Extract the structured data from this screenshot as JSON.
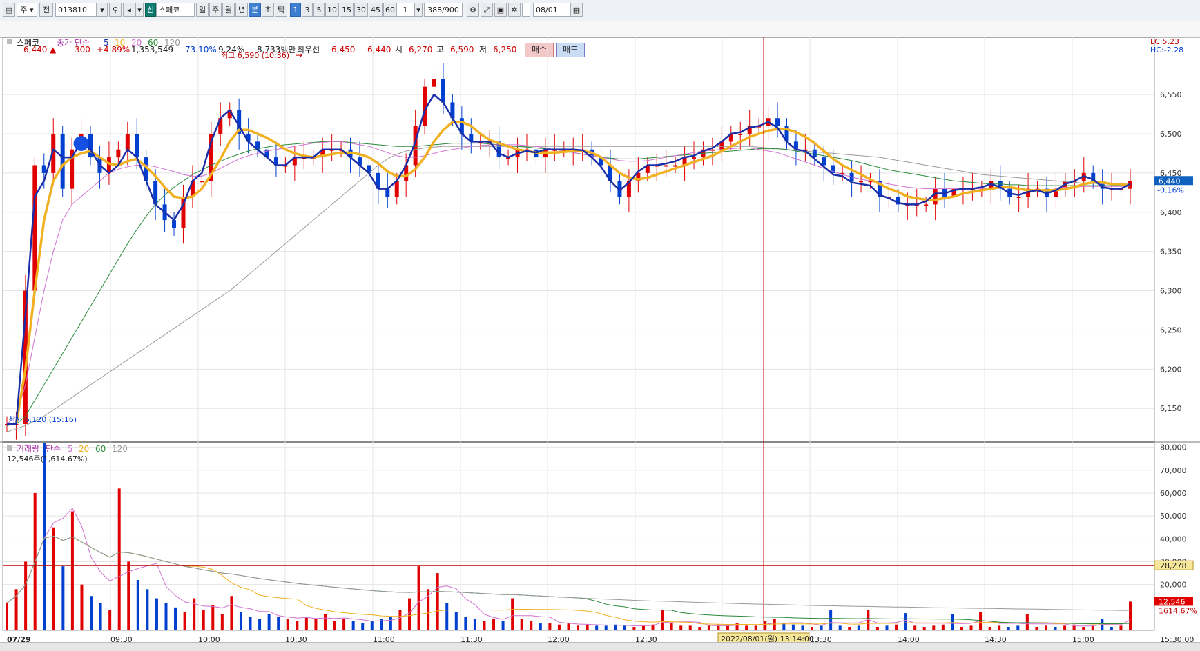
{
  "toolbar": {
    "market_mode": "주",
    "prev_label": "전",
    "stock_code": "013810",
    "new_badge": "신",
    "stock_name": "스페코",
    "period_buttons": [
      "일",
      "주",
      "월",
      "년",
      "분",
      "초",
      "틱"
    ],
    "minute_buttons": [
      "1",
      "3",
      "5",
      "10",
      "15",
      "30",
      "45",
      "60"
    ],
    "multiplier": "1",
    "count_display": "388/900",
    "date_value": "08/01"
  },
  "info": {
    "price": "6,440",
    "change": "300",
    "change_pct": "+4.89%",
    "volume": "1,353,549",
    "vol_ratio": "73.10%",
    "turnover": "9.24%",
    "amount": "8,733백만",
    "best_label": "최우선",
    "best_ask": "6,450",
    "best_bid": "6,440",
    "open_label": "시",
    "open": "6,270",
    "high_label": "고",
    "high": "6,590",
    "low_label": "저",
    "low": "6,250",
    "buy_label": "매수",
    "sell_label": "매도"
  },
  "chart_data": [
    {
      "type": "line",
      "title": "스페코",
      "legend": {
        "label": "종가 단순",
        "periods": [
          "5",
          "10",
          "20",
          "60",
          "120"
        ]
      },
      "y_ticks": [
        6150,
        6200,
        6250,
        6300,
        6350,
        6400,
        6450,
        6500,
        6550
      ],
      "ylim": [
        6108,
        6616
      ],
      "x_tick_labels": [
        "07/29",
        "09:30",
        "10:00",
        "10:30",
        "11:00",
        "11:30",
        "12:00",
        "12:30",
        "13:00",
        "13:30",
        "14:00",
        "14:30",
        "15:00",
        "15:30:00"
      ],
      "annotations": {
        "high": "최고 6,590 (10:36)",
        "low": "최저 6,120 (15:16)",
        "lc": "LC:5.23",
        "hc": "HC:-2.28",
        "last_price": "6,440",
        "last_change": "-0.16%",
        "crosshair_date": "2022/08/01(월) 13:14:00"
      },
      "colors": {
        "up": "#e00000",
        "down": "#0040d0",
        "ma5": "#1a2ea8",
        "ma10": "#f0b020",
        "ma20": "#d070d0",
        "ma60": "#2a8a3a",
        "ma120": "#999999"
      },
      "series": [
        {
          "name": "close",
          "values": [
            6130,
            6130,
            6300,
            6460,
            6450,
            6500,
            6430,
            6480,
            6500,
            6470,
            6450,
            6470,
            6480,
            6500,
            6470,
            6440,
            6410,
            6390,
            6380,
            6420,
            6440,
            6440,
            6500,
            6520,
            6530,
            6500,
            6490,
            6480,
            6470,
            6460,
            6460,
            6470,
            6470,
            6470,
            6480,
            6480,
            6480,
            6470,
            6460,
            6450,
            6430,
            6420,
            6440,
            6460,
            6510,
            6560,
            6570,
            6540,
            6520,
            6500,
            6490,
            6490,
            6490,
            6470,
            6470,
            6480,
            6480,
            6470,
            6480,
            6480,
            6480,
            6480,
            6480,
            6470,
            6460,
            6440,
            6420,
            6440,
            6450,
            6460,
            6460,
            6460,
            6460,
            6470,
            6470,
            6480,
            6480,
            6490,
            6500,
            6500,
            6510,
            6510,
            6520,
            6510,
            6490,
            6480,
            6480,
            6470,
            6460,
            6450,
            6450,
            6440,
            6440,
            6440,
            6420,
            6420,
            6410,
            6410,
            6410,
            6410,
            6430,
            6420,
            6430,
            6430,
            6430,
            6430,
            6440,
            6430,
            6420,
            6420,
            6430,
            6430,
            6420,
            6430,
            6440,
            6440,
            6450,
            6440,
            6430,
            6430,
            6430,
            6440
          ]
        },
        {
          "name": "ma5",
          "values": [
            6130,
            6130,
            6270,
            6420,
            6440,
            6480,
            6470,
            6470,
            6490,
            6480,
            6460,
            6450,
            6460,
            6480,
            6470,
            6440,
            6410,
            6400,
            6390,
            6410,
            6440,
            6450,
            6490,
            6520,
            6530,
            6510,
            6490,
            6480,
            6470,
            6460,
            6460,
            6470,
            6470,
            6470,
            6480,
            6480,
            6480,
            6470,
            6460,
            6450,
            6430,
            6430,
            6440,
            6460,
            6490,
            6530,
            6550,
            6540,
            6520,
            6500,
            6490,
            6490,
            6490,
            6475,
            6470,
            6475,
            6478,
            6476,
            6480,
            6480,
            6480,
            6480,
            6479,
            6470,
            6458,
            6440,
            6428,
            6438,
            6452,
            6460,
            6460,
            6462,
            6465,
            6470,
            6472,
            6478,
            6482,
            6490,
            6500,
            6502,
            6508,
            6510,
            6515,
            6508,
            6490,
            6480,
            6478,
            6468,
            6458,
            6448,
            6446,
            6438,
            6436,
            6434,
            6422,
            6418,
            6412,
            6410,
            6410,
            6414,
            6424,
            6424,
            6428,
            6430,
            6430,
            6432,
            6436,
            6432,
            6424,
            6422,
            6426,
            6428,
            6424,
            6428,
            6436,
            6440,
            6446,
            6442,
            6432,
            6430,
            6430,
            6436
          ]
        },
        {
          "name": "ma10",
          "values": [
            6130,
            6130,
            6200,
            6300,
            6390,
            6440,
            6460,
            6470,
            6475,
            6478,
            6470,
            6462,
            6460,
            6465,
            6468,
            6458,
            6446,
            6432,
            6420,
            6418,
            6420,
            6430,
            6448,
            6468,
            6490,
            6505,
            6505,
            6500,
            6495,
            6488,
            6480,
            6475,
            6472,
            6470,
            6472,
            6474,
            6476,
            6476,
            6474,
            6470,
            6462,
            6452,
            6446,
            6446,
            6455,
            6470,
            6490,
            6505,
            6515,
            6515,
            6510,
            6500,
            6492,
            6488,
            6484,
            6480,
            6478,
            6476,
            6476,
            6476,
            6477,
            6478,
            6478,
            6476,
            6470,
            6460,
            6450,
            6444,
            6442,
            6444,
            6448,
            6452,
            6456,
            6460,
            6464,
            6468,
            6472,
            6478,
            6484,
            6490,
            6496,
            6500,
            6504,
            6506,
            6506,
            6502,
            6496,
            6488,
            6478,
            6468,
            6460,
            6454,
            6448,
            6442,
            6436,
            6430,
            6426,
            6420,
            6418,
            6416,
            6416,
            6418,
            6420,
            6424,
            6426,
            6428,
            6430,
            6432,
            6432,
            6430,
            6428,
            6428,
            6428,
            6428,
            6430,
            6432,
            6436,
            6438,
            6438,
            6436,
            6436,
            6434
          ]
        },
        {
          "name": "ma20",
          "values": [
            6130,
            6140,
            6180,
            6240,
            6300,
            6350,
            6390,
            6410,
            6420,
            6430,
            6440,
            6450,
            6455,
            6458,
            6460,
            6460,
            6458,
            6455,
            6452,
            6448,
            6446,
            6446,
            6450,
            6456,
            6462,
            6468,
            6472,
            6475,
            6478,
            6480,
            6482,
            6484,
            6486,
            6488,
            6489,
            6490,
            6490,
            6488,
            6486,
            6484,
            6480,
            6476,
            6472,
            6470,
            6470,
            6472,
            6475,
            6478,
            6480,
            6482,
            6484,
            6485,
            6486,
            6486,
            6486,
            6486,
            6485,
            6484,
            6482,
            6480,
            6478,
            6476,
            6474,
            6472,
            6470,
            6468,
            6466,
            6465,
            6465,
            6466,
            6468,
            6470,
            6472,
            6474,
            6476,
            6478,
            6479,
            6480,
            6481,
            6482,
            6482,
            6480,
            6478,
            6476,
            6472,
            6468,
            6464,
            6460,
            6456,
            6452,
            6448,
            6445,
            6442,
            6440,
            6438,
            6436,
            6434,
            6432,
            6431,
            6430,
            6430,
            6430,
            6430,
            6430,
            6430,
            6430,
            6431,
            6431,
            6431,
            6431,
            6431,
            6431,
            6431,
            6431,
            6432,
            6432,
            6433,
            6433,
            6433,
            6433,
            6433,
            6434
          ]
        },
        {
          "name": "ma60",
          "values": [
            6128,
            6130,
            6140,
            6160,
            6180,
            6200,
            6220,
            6240,
            6260,
            6280,
            6300,
            6320,
            6340,
            6360,
            6378,
            6395,
            6410,
            6422,
            6432,
            6440,
            6448,
            6454,
            6460,
            6465,
            6470,
            6474,
            6478,
            6481,
            6483,
            6485,
            6486,
            6487,
            6488,
            6489,
            6490,
            6490,
            6490,
            6489,
            6488,
            6487,
            6486,
            6485,
            6484,
            6484,
            6484,
            6485,
            6486,
            6487,
            6488,
            6488,
            6488,
            6488,
            6487,
            6486,
            6485,
            6484,
            6483,
            6482,
            6481,
            6480,
            6478,
            6476,
            6474,
            6472,
            6470,
            6469,
            6468,
            6468,
            6468,
            6469,
            6470,
            6471,
            6472,
            6473,
            6474,
            6475,
            6476,
            6477,
            6478,
            6479,
            6480,
            6481,
            6481,
            6481,
            6480,
            6478,
            6476,
            6474,
            6472,
            6470,
            6468,
            6466,
            6463,
            6460,
            6457,
            6454,
            6452,
            6450,
            6448,
            6446,
            6444,
            6442,
            6440,
            6439,
            6438,
            6437,
            6436,
            6436,
            6435,
            6435,
            6434,
            6434,
            6434,
            6434,
            6434,
            6434,
            6434,
            6434,
            6434,
            6434,
            6434,
            6434
          ]
        },
        {
          "name": "ma120",
          "values": [
            6120,
            6124,
            6128,
            6134,
            6140,
            6148,
            6156,
            6164,
            6172,
            6180,
            6188,
            6196,
            6204,
            6212,
            6220,
            6228,
            6236,
            6244,
            6252,
            6260,
            6268,
            6276,
            6284,
            6292,
            6300,
            6310,
            6320,
            6330,
            6340,
            6350,
            6360,
            6370,
            6380,
            6390,
            6400,
            6410,
            6420,
            6430,
            6440,
            6450,
            6460,
            6468,
            6474,
            6478,
            6480,
            6482,
            6483,
            6484,
            6484,
            6484,
            6484,
            6484,
            6484,
            6484,
            6484,
            6484,
            6484,
            6484,
            6484,
            6484,
            6484,
            6484,
            6484,
            6484,
            6484,
            6484,
            6484,
            6484,
            6484,
            6484,
            6484,
            6484,
            6484,
            6484,
            6484,
            6484,
            6484,
            6484,
            6484,
            6484,
            6484,
            6483,
            6482,
            6481,
            6480,
            6479,
            6478,
            6477,
            6476,
            6475,
            6474,
            6473,
            6472,
            6471,
            6470,
            6468,
            6466,
            6464,
            6462,
            6460,
            6458,
            6456,
            6454,
            6452,
            6450,
            6448,
            6447,
            6446,
            6445,
            6444,
            6443,
            6442,
            6441,
            6440,
            6439,
            6438,
            6437,
            6437,
            6436,
            6436,
            6436,
            6436
          ]
        }
      ]
    },
    {
      "type": "bar",
      "title": "거래량",
      "legend": {
        "label": "단순",
        "periods": [
          "5",
          "20",
          "60",
          "120"
        ]
      },
      "subtitle": "12,546주(1,614.67%)",
      "y_ticks": [
        20000,
        30000,
        40000,
        50000,
        60000,
        70000,
        80000
      ],
      "y_tick_labels": [
        "20,000",
        "30,000",
        "40,000",
        "50,000",
        "60,000",
        "70,000",
        "80,000"
      ],
      "ylim": [
        0,
        82000
      ],
      "ref_line": 28278,
      "annotations": {
        "ref_value": "28,278",
        "last_volume": "12,546",
        "last_pct": "1614.67%"
      },
      "values": [
        12000,
        18000,
        30000,
        60000,
        82000,
        45000,
        28000,
        52000,
        20000,
        15000,
        12000,
        9000,
        62000,
        30000,
        22000,
        18000,
        14000,
        12000,
        10000,
        8000,
        14000,
        9000,
        11000,
        7000,
        15000,
        8000,
        6000,
        5000,
        7000,
        6000,
        5000,
        4000,
        6000,
        5000,
        7000,
        4000,
        5000,
        4000,
        3000,
        4000,
        5000,
        6000,
        9000,
        14000,
        28000,
        18000,
        25000,
        12000,
        8000,
        6000,
        5000,
        4000,
        5000,
        4000,
        14000,
        5000,
        4000,
        3000,
        3000,
        2500,
        3000,
        2000,
        2500,
        2000,
        2000,
        2500,
        2000,
        1500,
        2000,
        2500,
        9000,
        3000,
        2000,
        2000,
        1500,
        2000,
        2500,
        2000,
        3000,
        2000,
        2000,
        4000,
        5000,
        3000,
        2500,
        2000,
        1500,
        2000,
        9000,
        2000,
        1500,
        2000,
        9000,
        1500,
        2000,
        2500,
        7500,
        2000,
        1500,
        2000,
        2500,
        7000,
        1500,
        2000,
        8000,
        1500,
        2000,
        1500,
        2000,
        7000,
        1500,
        2000,
        1500,
        2000,
        2500,
        1500,
        2000,
        5000,
        1500,
        2000,
        12546
      ],
      "colors": {
        "up": "#e00000",
        "down": "#0040d0",
        "ma5": "#d070d0",
        "ma20": "#f0b020",
        "ma60": "#2a8a3a",
        "ma120": "#999999"
      }
    }
  ]
}
